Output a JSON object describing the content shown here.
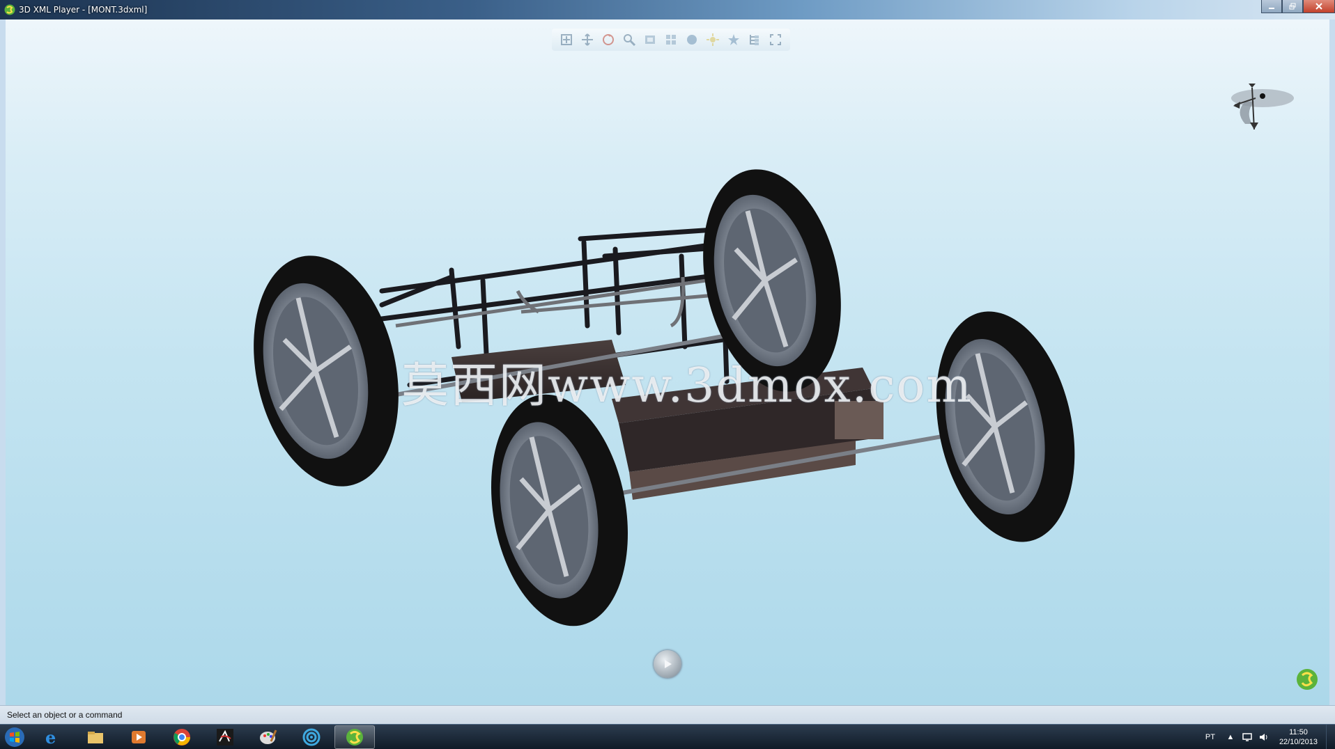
{
  "window": {
    "title": "3D XML Player - [MONT.3dxml]",
    "controls": [
      "minimize",
      "maximize",
      "close"
    ]
  },
  "toolbar": {
    "icons": [
      "fit-all-icon",
      "pan-icon",
      "rotate-icon",
      "zoom-icon",
      "view-icon",
      "multi-view-icon",
      "render-style-icon",
      "lighting-icon",
      "star-icon",
      "tree-icon",
      "fullscreen-icon"
    ]
  },
  "viewport": {
    "watermark": "莫西网www.3dmox.com",
    "model": "four-wheel chassis assembly"
  },
  "status": {
    "message": "Select an object or a command"
  },
  "taskbar": {
    "apps": [
      "internet-explorer-icon",
      "file-explorer-icon",
      "media-player-icon",
      "chrome-icon",
      "catia-icon",
      "paint-icon",
      "spiral-app-icon",
      "3dxml-player-icon"
    ],
    "active_app": "3dxml-player-icon",
    "language": "PT",
    "time": "11:50",
    "date": "22/10/2013"
  },
  "colors": {
    "sky_top": "#eef6fb",
    "sky_bottom": "#acd8ea",
    "tire": "#111111",
    "rim": "#b6bcc4",
    "frame": "#1a1a1f",
    "platform": "#3a3030"
  }
}
